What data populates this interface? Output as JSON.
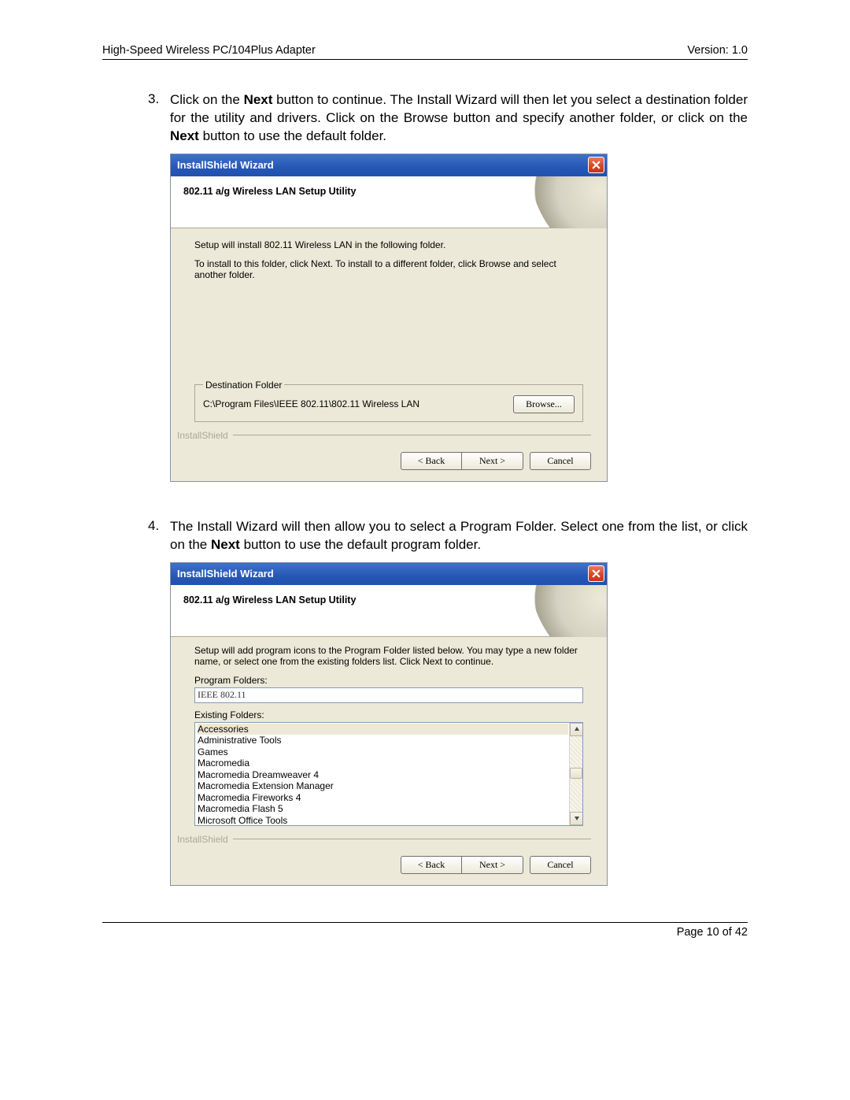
{
  "page": {
    "header_left": "High-Speed Wireless PC/104Plus Adapter",
    "header_right": "Version: 1.0",
    "footer": "Page 10 of 42"
  },
  "step3": {
    "num": "3.",
    "text_before_next1": "Click on the ",
    "bold_next1": "Next",
    "text_mid": " button to continue. The Install Wizard will then let you select a destination folder for the utility and drivers. Click on the Browse button and specify another folder, or click on the ",
    "bold_next2": "Next",
    "text_after": " button to use the default folder."
  },
  "step4": {
    "num": "4.",
    "text_before": "The Install Wizard will then allow you to select a Program Folder. Select one from the list, or click on the ",
    "bold_next": "Next",
    "text_after": " button to use the default program folder."
  },
  "dlg_common": {
    "title": "InstallShield Wizard",
    "subtitle": "802.11 a/g Wireless LAN Setup Utility",
    "installshield_label": "InstallShield",
    "back": "< Back",
    "next": "Next >",
    "cancel": "Cancel"
  },
  "dlg1": {
    "line1": "Setup will install 802.11 Wireless LAN in the following folder.",
    "line2": "To install to this folder, click Next. To install to a different folder, click Browse and select another folder.",
    "dest_legend": "Destination Folder",
    "dest_path": "C:\\Program Files\\IEEE 802.11\\802.11 Wireless LAN",
    "browse": "Browse..."
  },
  "dlg2": {
    "line1": "Setup will add program icons to the Program Folder listed below.  You may type a new folder name, or select one from the existing folders list.  Click Next to continue.",
    "program_folders_label": "Program Folders:",
    "program_folders_value": "IEEE 802.11",
    "existing_folders_label": "Existing Folders:",
    "folders": [
      "Accessories",
      "Administrative Tools",
      "Games",
      "Macromedia",
      "Macromedia Dreamweaver 4",
      "Macromedia Extension Manager",
      "Macromedia Fireworks 4",
      "Macromedia Flash 5",
      "Microsoft Office Tools"
    ]
  }
}
